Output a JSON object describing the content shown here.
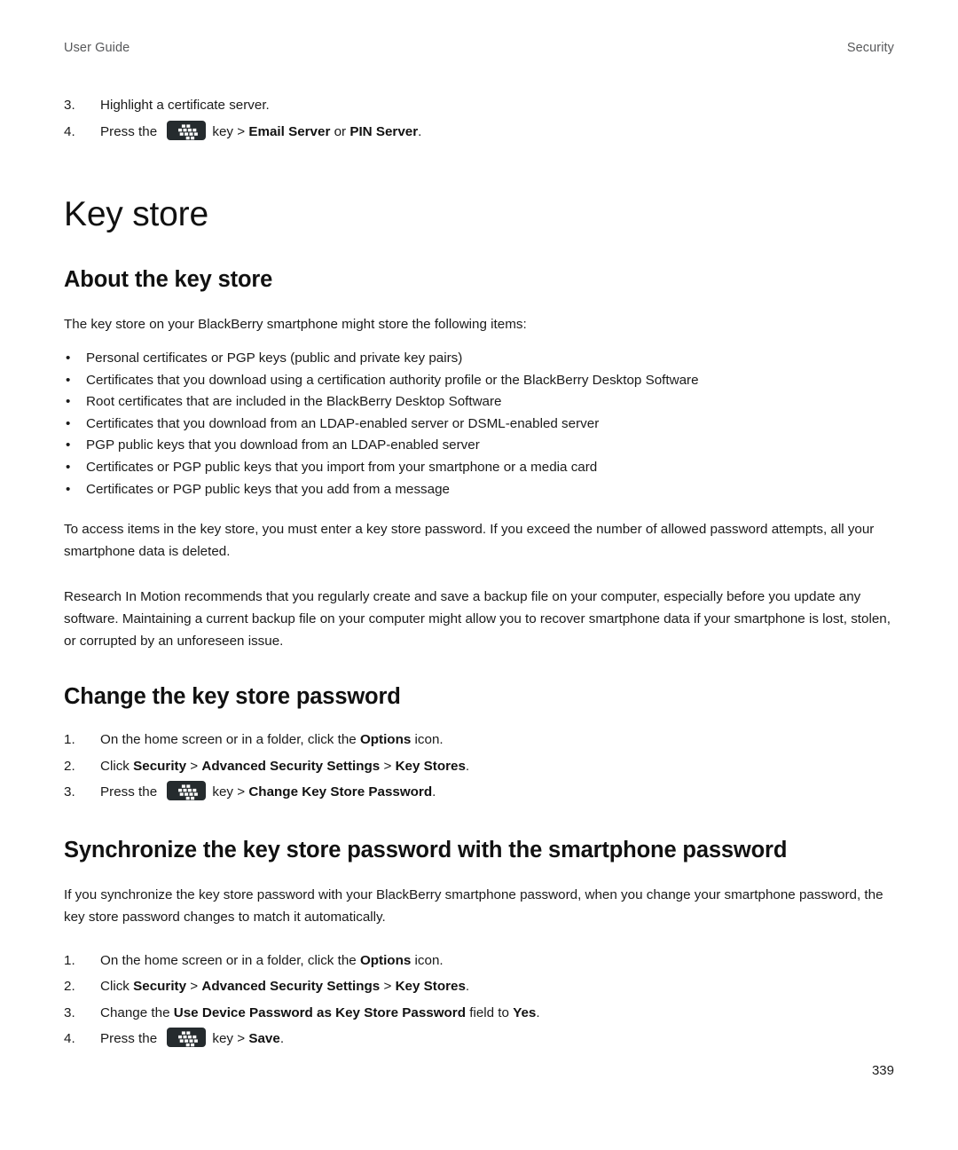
{
  "running_head": {
    "left": "User Guide",
    "right": "Security"
  },
  "icons": {
    "menu_key": "blackberry-menu-key-icon"
  },
  "top_steps": [
    {
      "num": "3.",
      "parts": [
        {
          "t": "text",
          "v": "Highlight a certificate server."
        }
      ]
    },
    {
      "num": "4.",
      "parts": [
        {
          "t": "text",
          "v": "Press the "
        },
        {
          "t": "icon",
          "v": "blackberry-menu-key-icon"
        },
        {
          "t": "text",
          "v": "key > "
        },
        {
          "t": "bold",
          "v": "Email Server"
        },
        {
          "t": "text",
          "v": " or "
        },
        {
          "t": "bold",
          "v": "PIN Server"
        },
        {
          "t": "text",
          "v": "."
        }
      ]
    }
  ],
  "title": "Key store",
  "about": {
    "heading": "About the key store",
    "intro": "The key store on your BlackBerry smartphone might store the following items:",
    "bullets": [
      "Personal certificates or PGP keys (public and private key pairs)",
      "Certificates that you download using a certification authority profile or the BlackBerry Desktop Software",
      "Root certificates that are included in the BlackBerry Desktop Software",
      "Certificates that you download from an LDAP-enabled server or DSML-enabled server",
      "PGP public keys that you download from an LDAP-enabled server",
      "Certificates or PGP public keys that you import from your smartphone or a media card",
      "Certificates or PGP public keys that you add from a message"
    ],
    "paragraph_1": "To access items in the key store, you must enter a key store password. If you exceed the number of allowed password attempts, all your smartphone data is deleted.",
    "paragraph_2": "Research In Motion recommends that you regularly create and save a backup file on your computer, especially before you update any software. Maintaining a current backup file on your computer might allow you to recover smartphone data if your smartphone is lost, stolen, or corrupted by an unforeseen issue."
  },
  "change_password": {
    "heading": "Change the key store password",
    "steps": [
      {
        "num": "1.",
        "parts": [
          {
            "t": "text",
            "v": "On the home screen or in a folder, click the "
          },
          {
            "t": "bold",
            "v": "Options"
          },
          {
            "t": "text",
            "v": " icon."
          }
        ]
      },
      {
        "num": "2.",
        "parts": [
          {
            "t": "text",
            "v": "Click "
          },
          {
            "t": "bold",
            "v": "Security"
          },
          {
            "t": "text",
            "v": " > "
          },
          {
            "t": "bold",
            "v": "Advanced Security Settings"
          },
          {
            "t": "text",
            "v": " > "
          },
          {
            "t": "bold",
            "v": "Key Stores"
          },
          {
            "t": "text",
            "v": "."
          }
        ]
      },
      {
        "num": "3.",
        "parts": [
          {
            "t": "text",
            "v": "Press the "
          },
          {
            "t": "icon",
            "v": "blackberry-menu-key-icon"
          },
          {
            "t": "text",
            "v": "key > "
          },
          {
            "t": "bold",
            "v": "Change Key Store Password"
          },
          {
            "t": "text",
            "v": "."
          }
        ]
      }
    ]
  },
  "synchronize": {
    "heading": "Synchronize the key store password with the smartphone password",
    "paragraph": "If you synchronize the key store password with your BlackBerry smartphone password, when you change your smartphone password, the key store password changes to match it automatically.",
    "steps": [
      {
        "num": "1.",
        "parts": [
          {
            "t": "text",
            "v": "On the home screen or in a folder, click the "
          },
          {
            "t": "bold",
            "v": "Options"
          },
          {
            "t": "text",
            "v": " icon."
          }
        ]
      },
      {
        "num": "2.",
        "parts": [
          {
            "t": "text",
            "v": "Click "
          },
          {
            "t": "bold",
            "v": "Security"
          },
          {
            "t": "text",
            "v": " > "
          },
          {
            "t": "bold",
            "v": "Advanced Security Settings"
          },
          {
            "t": "text",
            "v": " > "
          },
          {
            "t": "bold",
            "v": "Key Stores"
          },
          {
            "t": "text",
            "v": "."
          }
        ]
      },
      {
        "num": "3.",
        "parts": [
          {
            "t": "text",
            "v": "Change the "
          },
          {
            "t": "bold",
            "v": "Use Device Password as Key Store Password"
          },
          {
            "t": "text",
            "v": " field to "
          },
          {
            "t": "bold",
            "v": "Yes"
          },
          {
            "t": "text",
            "v": "."
          }
        ]
      },
      {
        "num": "4.",
        "parts": [
          {
            "t": "text",
            "v": "Press the "
          },
          {
            "t": "icon",
            "v": "blackberry-menu-key-icon"
          },
          {
            "t": "text",
            "v": "key > "
          },
          {
            "t": "bold",
            "v": "Save"
          },
          {
            "t": "text",
            "v": "."
          }
        ]
      }
    ]
  },
  "bullet_glyph": "•",
  "page_number": "339",
  "colors": {
    "text": "#1a1a1a",
    "heading": "#111111",
    "running_head": "#58595b",
    "key_icon_bg": "#252b2e",
    "key_icon_fg": "#ffffff"
  }
}
